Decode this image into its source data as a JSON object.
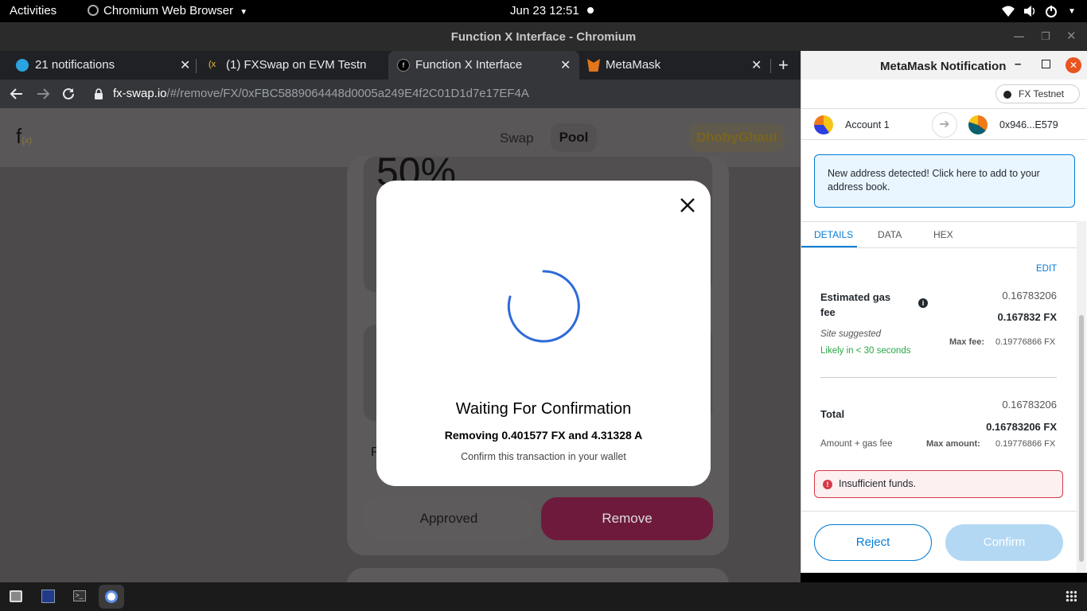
{
  "topbar": {
    "activities": "Activities",
    "app_name": "Chromium Web Browser",
    "datetime": "Jun 23  12:51"
  },
  "window": {
    "title": "Function X Interface - Chromium"
  },
  "tabs": [
    {
      "label": "21 notifications"
    },
    {
      "label": "(1) FXSwap on EVM Testn"
    },
    {
      "label": "Function X Interface"
    },
    {
      "label": "MetaMask"
    }
  ],
  "address_bar": {
    "domain": "fx-swap.io",
    "path": "/#/remove/FX/0xFBC5889064448d0005a249E4f2C01D1d7e17EF4A"
  },
  "site": {
    "logo_text": "f",
    "logo_sub": "(x)",
    "nav_swap": "Swap",
    "nav_pool": "Pool",
    "network_label": "DhobyGhaut",
    "percent_partial": "50%",
    "letter_partial": "P",
    "approved_label": "Approved",
    "remove_label": "Remove"
  },
  "modal": {
    "title": "Waiting For Confirmation",
    "subtitle": "Removing 0.401577 FX and 4.31328 A",
    "hint": "Confirm this transaction in your wallet"
  },
  "metamask": {
    "window_title": "MetaMask Notification",
    "network": "FX Testnet",
    "from_account": "Account 1",
    "to_account": "0x946...E579",
    "alert": "New address detected! Click here to add to your address book.",
    "tabs": [
      "DETAILS",
      "DATA",
      "HEX"
    ],
    "edit": "EDIT",
    "gas_label_1": "Estimated gas",
    "gas_label_2": "fee",
    "gas_value_small": "0.16783206",
    "gas_value_bold": "0.167832 FX",
    "site_suggested": "Site suggested",
    "likely": "Likely in < 30 seconds",
    "max_fee_label": "Max fee:",
    "max_fee_value": "0.19776866 FX",
    "total_label": "Total",
    "total_small": "0.16783206",
    "total_bold": "0.16783206 FX",
    "amount_gas": "Amount + gas fee",
    "max_amount_label": "Max amount:",
    "max_amount_value": "0.19776866 FX",
    "error": "Insufficient funds.",
    "reject": "Reject",
    "confirm": "Confirm"
  },
  "colors": {
    "accent_pink": "#e2136e",
    "metamask_blue": "#037dd6",
    "spinner_blue": "#2f6bd9",
    "success_green": "#28a745",
    "error_red": "#d73a49"
  }
}
